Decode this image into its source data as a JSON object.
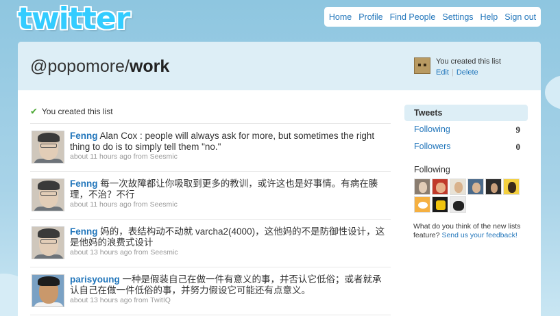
{
  "logo": {
    "text": "twitter"
  },
  "nav": {
    "home": "Home",
    "profile": "Profile",
    "find_people": "Find People",
    "settings": "Settings",
    "help": "Help",
    "sign_out": "Sign out"
  },
  "list": {
    "owner_prefix": "@popomore/",
    "name": "work",
    "owner_note": "You created this list",
    "edit": "Edit",
    "delete": "Delete",
    "created_note": "You created this list"
  },
  "tweets": [
    {
      "author": "Fenng",
      "text": "Alan Cox : people will always ask for more, but sometimes the right thing to do is to simply tell them \"no.\"",
      "time": "about 11 hours ago",
      "from_label": "from",
      "source": "Seesmic"
    },
    {
      "author": "Fenng",
      "text": "每一次故障都让你吸取到更多的教训，或许这也是好事情。有病在腠理，不治？不行",
      "time": "about 11 hours ago",
      "from_label": "from",
      "source": "Seesmic"
    },
    {
      "author": "Fenng",
      "text": "妈的，表结构动不动就 varcha2(4000)，这他妈的不是防御性设计，这是他妈的浪费式设计",
      "time": "about 13 hours ago",
      "from_label": "from",
      "source": "Seesmic"
    },
    {
      "author": "parisyoung",
      "text": "一种是假装自己在做一件有意义的事，并否认它低俗；或者就承认自己在做一件低俗的事，并努力假设它可能还有点意义。",
      "time": "about 13 hours ago",
      "from_label": "from",
      "source": "TwitIQ"
    }
  ],
  "sidebar": {
    "tweets_tab": "Tweets",
    "following_label": "Following",
    "following_count": "9",
    "followers_label": "Followers",
    "followers_count": "0",
    "following_head": "Following",
    "feedback_q": "What do you think of the new lists feature?",
    "feedback_link": "Send us your feedback!"
  },
  "colors": {
    "link": "#2276bb",
    "header_bg": "#ddeef6",
    "page_bg": "#a8d3e8",
    "check": "#4aa732"
  }
}
